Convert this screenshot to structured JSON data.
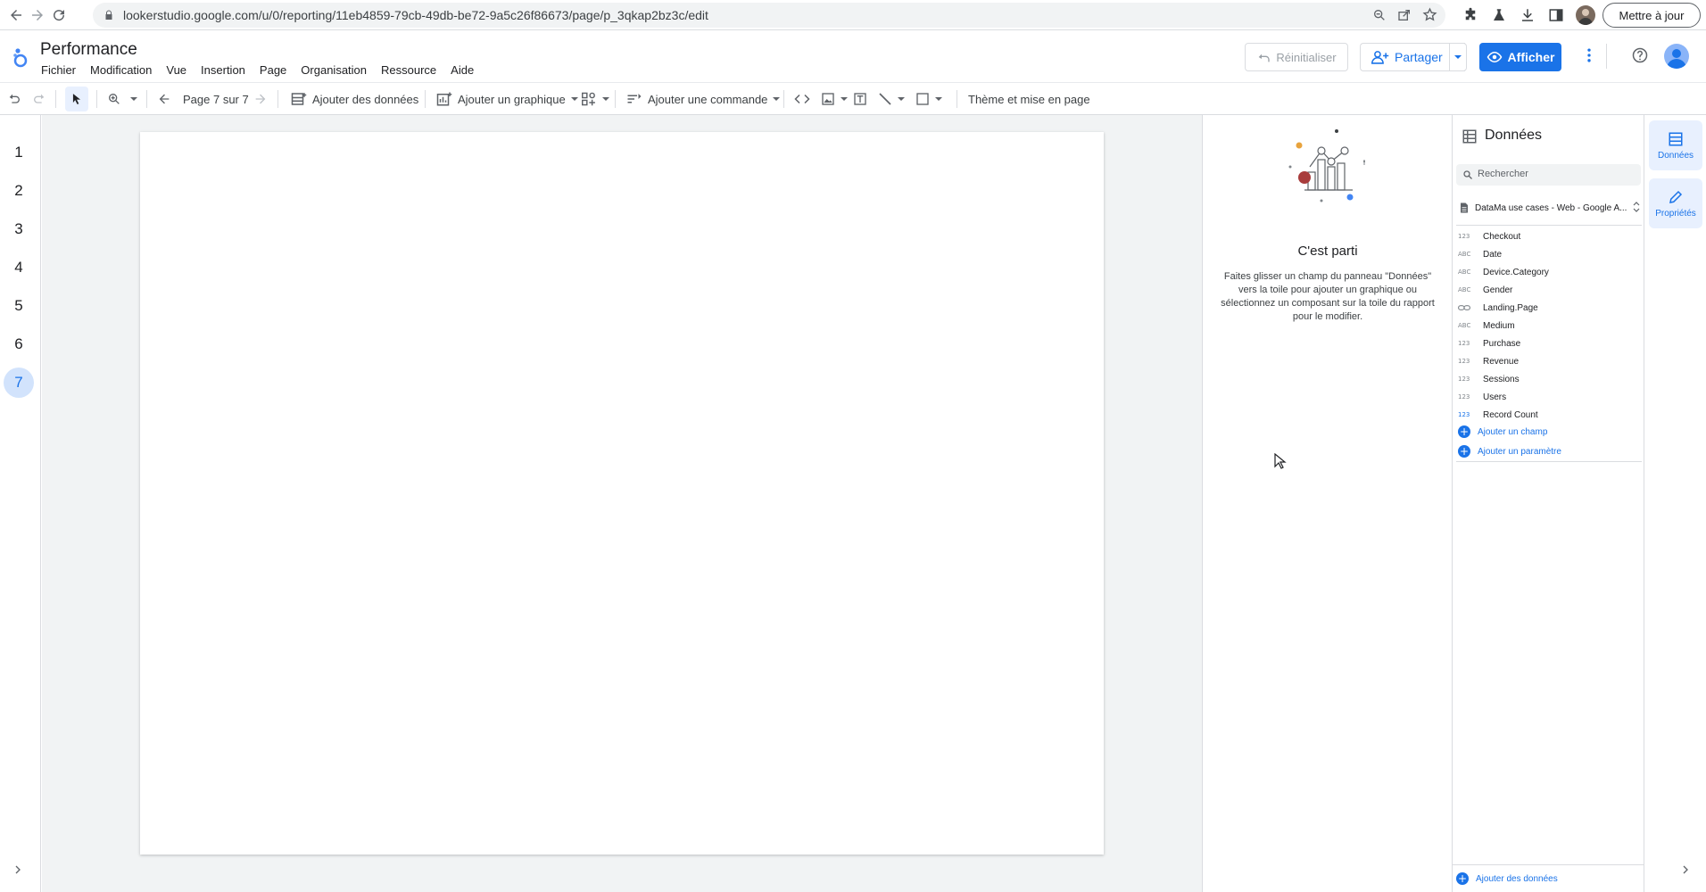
{
  "browser": {
    "url": "lookerstudio.google.com/u/0/reporting/11eb4859-79cb-49db-be72-9a5c26f86673/page/p_3qkap2bz3c/edit",
    "update_label": "Mettre à jour"
  },
  "header": {
    "title": "Performance",
    "menu": [
      "Fichier",
      "Modification",
      "Vue",
      "Insertion",
      "Page",
      "Organisation",
      "Ressource",
      "Aide"
    ],
    "reset_label": "Réinitialiser",
    "share_label": "Partager",
    "view_label": "Afficher"
  },
  "toolbar": {
    "page_indicator": "Page 7 sur 7",
    "add_data_label": "Ajouter des données",
    "add_chart_label": "Ajouter un graphique",
    "add_control_label": "Ajouter une commande",
    "theme_label": "Thème et mise en page"
  },
  "pages": [
    "1",
    "2",
    "3",
    "4",
    "5",
    "6",
    "7"
  ],
  "active_page": "7",
  "properties_panel": {
    "title": "C'est parti",
    "description": "Faites glisser un champ du panneau \"Données\" vers la toile pour ajouter un graphique ou sélectionnez un composant sur la toile du rapport pour le modifier."
  },
  "data_panel": {
    "title": "Données",
    "search_placeholder": "Rechercher",
    "source": "DataMa use cases - Web - Google A...",
    "fields": [
      {
        "type": "123",
        "name": "Checkout"
      },
      {
        "type": "ABC",
        "name": "Date"
      },
      {
        "type": "ABC",
        "name": "Device.Category"
      },
      {
        "type": "ABC",
        "name": "Gender"
      },
      {
        "type": "LINK",
        "name": "Landing.Page"
      },
      {
        "type": "ABC",
        "name": "Medium"
      },
      {
        "type": "123",
        "name": "Purchase"
      },
      {
        "type": "123",
        "name": "Revenue"
      },
      {
        "type": "123",
        "name": "Sessions"
      },
      {
        "type": "123",
        "name": "Users"
      },
      {
        "type": "123",
        "name": "Record Count"
      }
    ],
    "add_field_label": "Ajouter un champ",
    "add_param_label": "Ajouter un paramètre",
    "add_data_label": "Ajouter des données"
  },
  "right_rail": {
    "data_tab": "Données",
    "props_tab": "Propriétés"
  },
  "colors": {
    "accent": "#1a73e8",
    "active_page_bg": "#d2e3fc",
    "canvas_bg": "#f1f3f4"
  }
}
